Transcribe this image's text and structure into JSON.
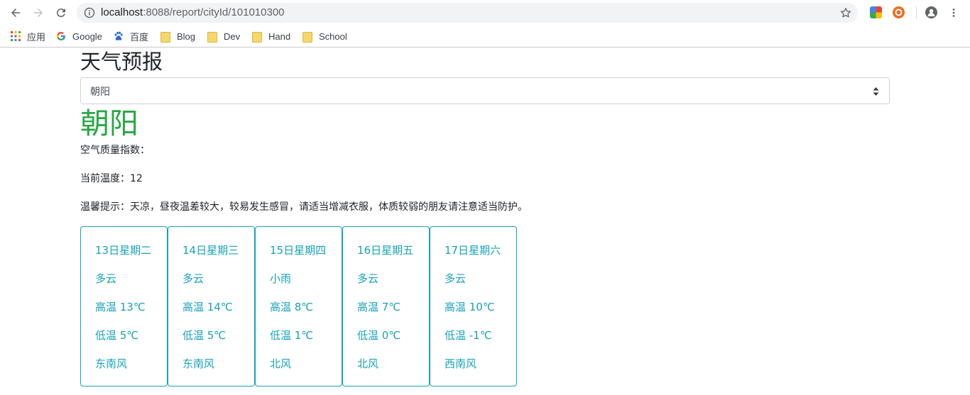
{
  "browser": {
    "url_host": "localhost",
    "url_rest": ":8088/report/cityId/101010300",
    "bookmarks": [
      {
        "label": "应用",
        "icon": "apps-grid-icon"
      },
      {
        "label": "Google",
        "icon": "google-icon"
      },
      {
        "label": "百度",
        "icon": "baidu-icon"
      },
      {
        "label": "Blog",
        "icon": "folder-icon"
      },
      {
        "label": "Dev",
        "icon": "folder-icon"
      },
      {
        "label": "Hand",
        "icon": "folder-icon"
      },
      {
        "label": "School",
        "icon": "folder-icon"
      }
    ]
  },
  "page": {
    "title": "天气预报",
    "select_value": "朝阳",
    "city": "朝阳",
    "aqi_label": "空气质量指数：",
    "temp_line": "当前温度：12",
    "tip_line": "温馨提示：天凉，昼夜温差较大，较易发生感冒，请适当增减衣服，体质较弱的朋友请注意适当防护。"
  },
  "forecast": [
    {
      "date": "13日星期二",
      "weather": "多云",
      "high": "高温 13℃",
      "low": "低温 5℃",
      "wind": "东南风"
    },
    {
      "date": "14日星期三",
      "weather": "多云",
      "high": "高温 14℃",
      "low": "低温 5℃",
      "wind": "东南风"
    },
    {
      "date": "15日星期四",
      "weather": "小雨",
      "high": "高温 8℃",
      "low": "低温 1℃",
      "wind": "北风"
    },
    {
      "date": "16日星期五",
      "weather": "多云",
      "high": "高温 7℃",
      "low": "低温 0℃",
      "wind": "北风"
    },
    {
      "date": "17日星期六",
      "weather": "多云",
      "high": "高温 10℃",
      "low": "低温 -1℃",
      "wind": "西南风"
    }
  ],
  "colors": {
    "accent_green": "#28a745",
    "card_teal": "#17a2b8"
  }
}
